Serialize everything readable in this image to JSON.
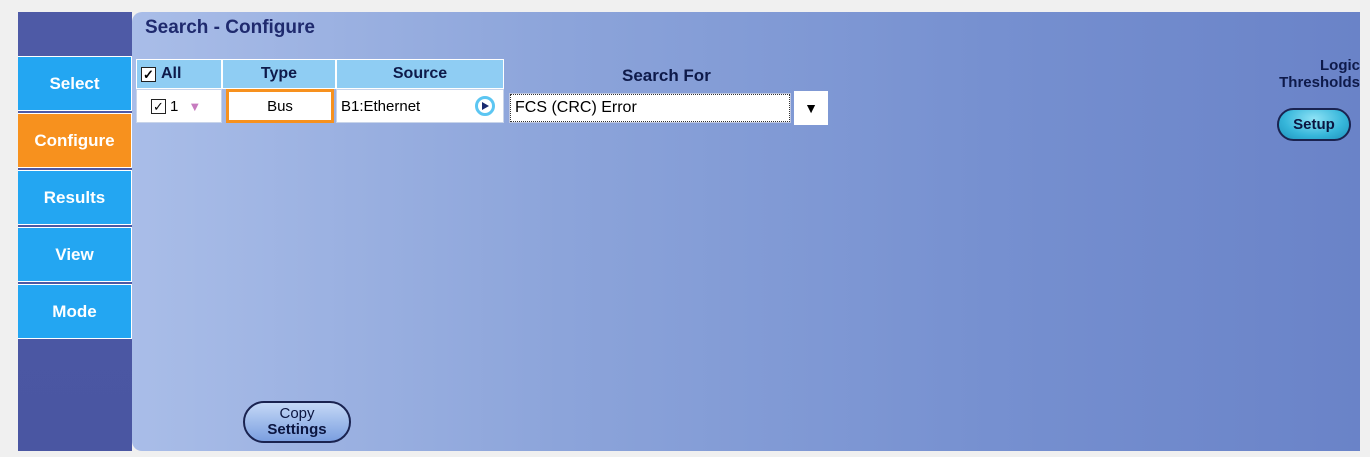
{
  "sidebar": {
    "items": [
      {
        "label": "Select",
        "active": false
      },
      {
        "label": "Configure",
        "active": true
      },
      {
        "label": "Results",
        "active": false
      },
      {
        "label": "View",
        "active": false
      },
      {
        "label": "Mode",
        "active": false
      }
    ]
  },
  "panel": {
    "title": "Search - Configure"
  },
  "table": {
    "headers": {
      "all": "All",
      "type": "Type",
      "source": "Source"
    },
    "rows": [
      {
        "index": "1",
        "checked": true,
        "type": "Bus",
        "source": "B1:Ethernet"
      }
    ]
  },
  "search_for": {
    "label": "Search For",
    "value": "FCS (CRC) Error"
  },
  "logic_thresholds": {
    "label_line1": "Logic",
    "label_line2": "Thresholds",
    "setup_label": "Setup"
  },
  "copy_settings": {
    "line1": "Copy",
    "line2": "Settings"
  },
  "colors": {
    "sidebar_item": "#23a6f2",
    "sidebar_active": "#f7911e",
    "header_cell": "#8fcdf3",
    "title_text": "#1f2a6e"
  }
}
